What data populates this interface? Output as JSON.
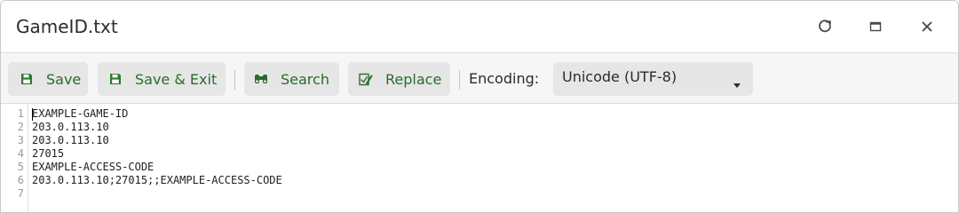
{
  "window": {
    "title": "GameID.txt",
    "controls": [
      {
        "name": "reload",
        "icon": "reload-icon"
      },
      {
        "name": "maximize",
        "icon": "maximize-icon"
      },
      {
        "name": "close",
        "icon": "close-icon"
      }
    ]
  },
  "toolbar": {
    "save_label": "Save",
    "save_icon": "floppy-disk-icon",
    "save_exit_label": "Save & Exit",
    "save_exit_icon": "floppy-disk-icon",
    "search_label": "Search",
    "search_icon": "binoculars-icon",
    "replace_label": "Replace",
    "replace_icon": "replace-icon",
    "encoding_label": "Encoding:",
    "encoding_value": "Unicode (UTF-8)",
    "accent_color": "#2d6a2d"
  },
  "editor": {
    "line_numbers": [
      "1",
      "2",
      "3",
      "4",
      "5",
      "6",
      "7"
    ],
    "lines": [
      "EXAMPLE-GAME-ID",
      "203.0.113.10",
      "203.0.113.10",
      "27015",
      "EXAMPLE-ACCESS-CODE",
      "203.0.113.10;27015;;EXAMPLE-ACCESS-CODE",
      ""
    ]
  }
}
